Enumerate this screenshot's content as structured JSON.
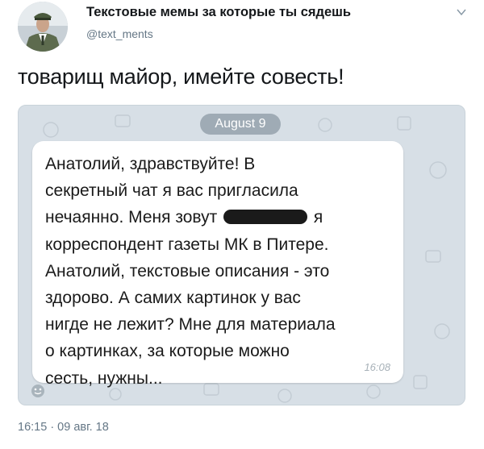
{
  "author": {
    "name": "Текстовые мемы за которые ты сядешь",
    "handle": "@text_ments",
    "menu_icon": "chevron-down-icon"
  },
  "tweet": {
    "text": "товарищ майор, имейте совесть!",
    "timestamp": "16:15 · 09 авг. 18"
  },
  "screenshot": {
    "date_label": "August 9",
    "message_lines": [
      "Анатолий, здравствуйте! В",
      "секретный чат я вас пригласила",
      "нечаянно. Меня зовут",
      "я",
      "корреспондент газеты МК в Питере.",
      "Анатолий, текстовые описания - это",
      "здорово. А самих картинок у вас",
      "нигде не лежит? Мне для материала",
      "о картинках, за которые можно",
      "сесть, нужны..."
    ],
    "message_time": "16:08",
    "emoji_icon": "smiley-icon",
    "background_color": "#d7dfe6"
  }
}
